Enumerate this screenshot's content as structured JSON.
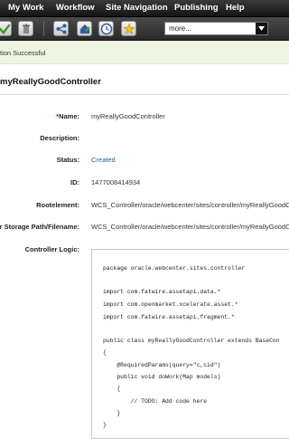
{
  "menu": {
    "items": [
      "My Work",
      "Workflow",
      "Site Navigation",
      "Publishing",
      "Help"
    ]
  },
  "toolbar": {
    "buttons": [
      "check-icon",
      "trash-icon",
      "share-icon",
      "bookmark-icon",
      "history-icon",
      "star-icon"
    ],
    "dropdown_value": "more..."
  },
  "status": {
    "message": "tion Successful"
  },
  "asset": {
    "title": "myReallyGoodController"
  },
  "fields": {
    "name_label": "Name:",
    "name_required_mark": "*",
    "name_value": "myReallyGoodController",
    "description_label": "Description:",
    "description_value": "",
    "status_label": "Status:",
    "status_value": "Created",
    "id_label": "ID:",
    "id_value": "1477008414934",
    "rootelement_label": "Rootelement:",
    "rootelement_value": "WCS_Controller/oracle/webcenter/sites/controller/myReallyGoodContr",
    "storage_label": "r Storage Path/Filename:",
    "storage_value": "WCS_Controller/oracle/webcenter/sites/controller/myReallyGoodContr",
    "logic_label": "Controller Logic:"
  },
  "code": {
    "lines": [
      "package oracle.webcenter.sites.controller",
      "",
      "import com.fatwire.assetapi.data.*",
      "import com.openmarket.xcelerate.asset.*",
      "import com.fatwire.assetapi.fragment.*",
      "",
      "public class myReallyGoodController extends BaseCon",
      "{",
      "    @RequiredParams(query=\"c,cid\")",
      "    public void doWork(Map models)",
      "    {",
      "        // TODO: Add code here",
      "    }",
      "}"
    ]
  },
  "colors": {
    "menubar": "#1f1f1f",
    "status_background": "#eef5e1",
    "link": "#1e5fa8",
    "required": "#cc0000"
  }
}
